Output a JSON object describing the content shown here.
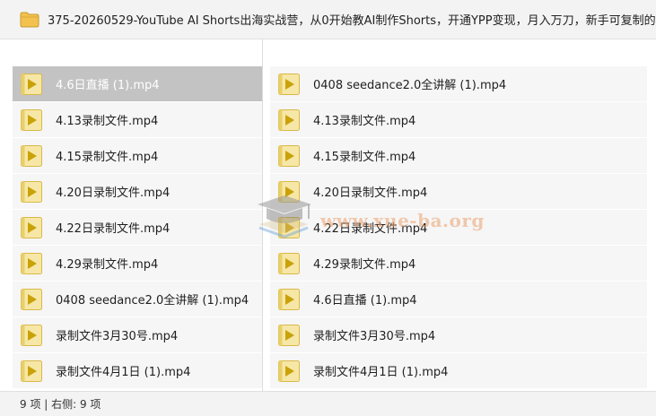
{
  "title": "375-20260529-YouTube AI Shorts出海实战营，从0开始教AI制作Shorts，开通YPP变现，月入万刀，新手可复制的",
  "left_pane": {
    "files": [
      "4.6日直播 (1).mp4",
      "4.13录制文件.mp4",
      "4.15录制文件.mp4",
      "4.20日录制文件.mp4",
      "4.22日录制文件.mp4",
      "4.29录制文件.mp4",
      "0408 seedance2.0全讲解 (1).mp4",
      "录制文件3月30号.mp4",
      "录制文件4月1日 (1).mp4"
    ],
    "selected_index": 0
  },
  "right_pane": {
    "files": [
      "0408 seedance2.0全讲解 (1).mp4",
      "4.13录制文件.mp4",
      "4.15录制文件.mp4",
      "4.20日录制文件.mp4",
      "4.22日录制文件.mp4",
      "4.29录制文件.mp4",
      "4.6日直播 (1).mp4",
      "录制文件3月30号.mp4",
      "录制文件4月1日 (1).mp4"
    ]
  },
  "status": "9 项 | 右侧: 9 项",
  "watermark": "www.xue-ba.org",
  "icons": {
    "title": "folder-icon",
    "file": "video-file-icon",
    "watermark": "graduation-cap-logo"
  },
  "colors": {
    "folder": "#f2c14e",
    "file_icon_bg": "#f7e7a6",
    "file_icon_play": "#c9a20a",
    "selected_row": "#c3c3c3"
  }
}
